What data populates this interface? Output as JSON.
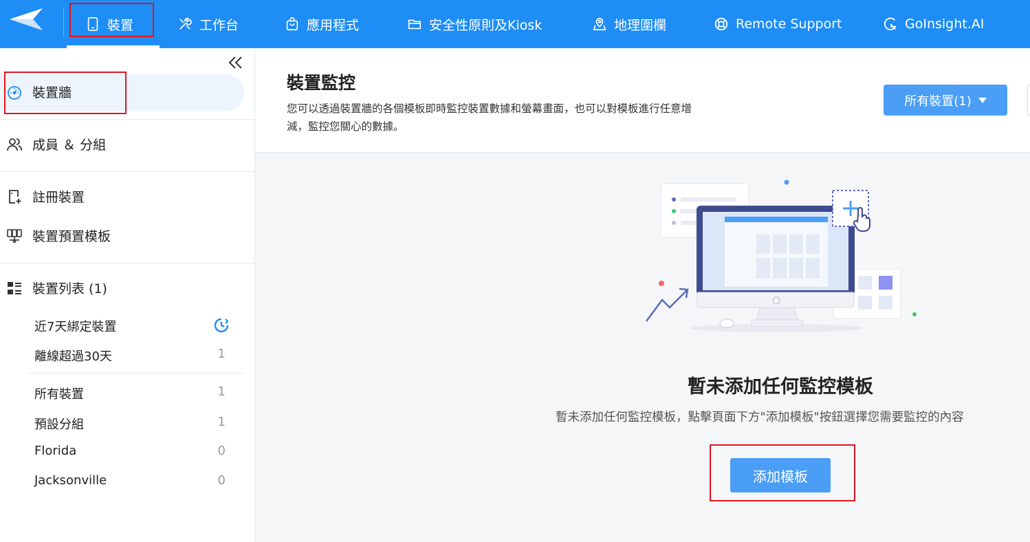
{
  "nav": {
    "items": [
      {
        "label": "裝置",
        "icon": "tablet-icon"
      },
      {
        "label": "工作台",
        "icon": "tools-icon"
      },
      {
        "label": "應用程式",
        "icon": "shopping-bag-icon"
      },
      {
        "label": "安全性原則及Kiosk",
        "icon": "folder-icon"
      },
      {
        "label": "地理圍欄",
        "icon": "map-pin-icon"
      },
      {
        "label": "Remote Support",
        "icon": "lifebuoy-icon"
      },
      {
        "label": "GoInsight.AI",
        "icon": "goinsight-icon"
      }
    ]
  },
  "sidebar": {
    "items": [
      {
        "label": "裝置牆"
      },
      {
        "label": "成員 ＆ 分組"
      },
      {
        "label": "註冊裝置"
      },
      {
        "label": "裝置預置模板"
      },
      {
        "label": "裝置列表 (1)"
      }
    ],
    "sub": [
      {
        "label": "近7天綁定裝置",
        "count": ""
      },
      {
        "label": "離線超過30天",
        "count": "1"
      },
      {
        "label": "所有裝置",
        "count": "1"
      },
      {
        "label": "預設分組",
        "count": "1"
      },
      {
        "label": "Florida",
        "count": "0"
      },
      {
        "label": "Jacksonville",
        "count": "0"
      }
    ]
  },
  "main": {
    "title": "裝置監控",
    "description": "您可以透過裝置牆的各個模板即時監控裝置數據和螢幕畫面，也可以對模板進行任意增減，監控您關心的數據。",
    "filter_label": "所有裝置(1)",
    "empty_title": "暫未添加任何監控模板",
    "empty_desc": "暫未添加任何監控模板，點擊頁面下方\"添加模板\"按鈕選擇您需要監控的內容",
    "add_button": "添加模板"
  },
  "colors": {
    "primary": "#1e8df5",
    "button": "#4b9ef5",
    "highlight": "#e0141e"
  }
}
